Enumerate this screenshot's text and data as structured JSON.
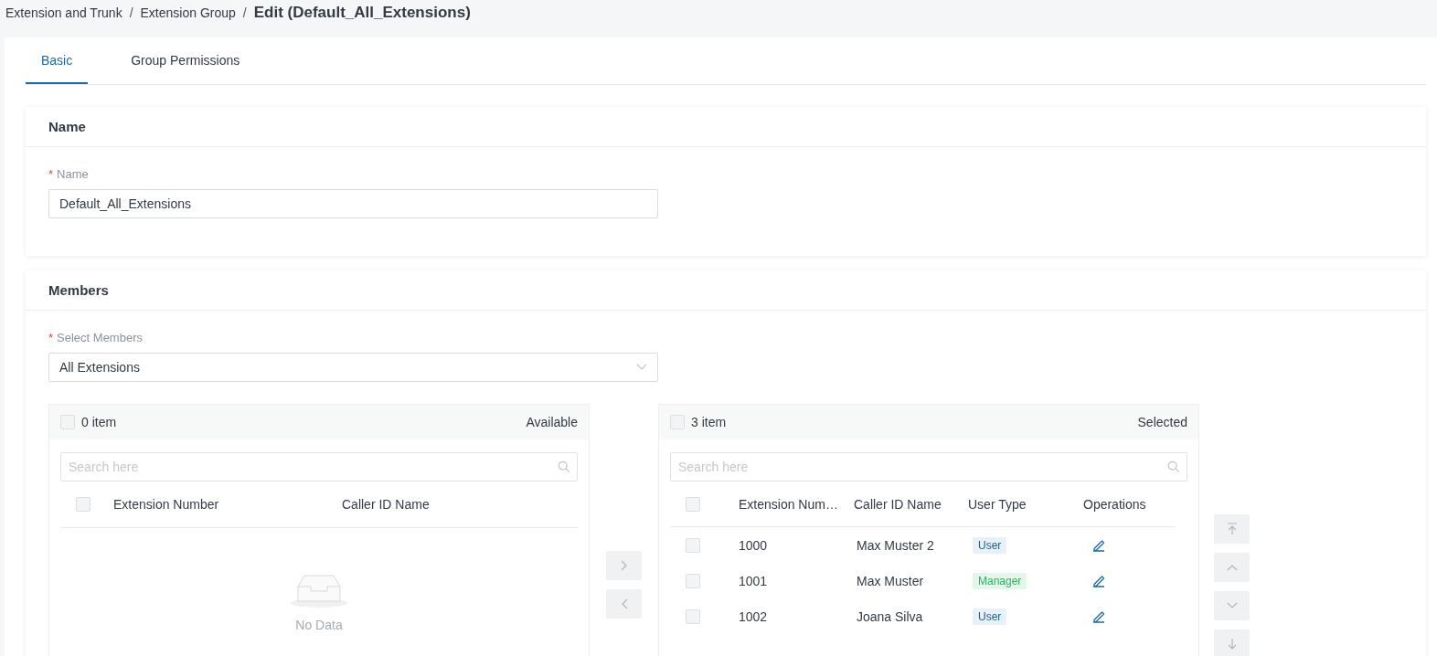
{
  "breadcrumb": {
    "items": [
      "Extension and Trunk",
      "Extension Group"
    ],
    "separator": "/",
    "current": "Edit (Default_All_Extensions)"
  },
  "tabs": [
    {
      "label": "Basic",
      "selected": true
    },
    {
      "label": "Group Permissions",
      "selected": false
    }
  ],
  "name_section": {
    "title": "Name",
    "field": {
      "required_mark": "*",
      "label": "Name",
      "value": "Default_All_Extensions"
    }
  },
  "members_section": {
    "title": "Members",
    "select": {
      "required_mark": "*",
      "label": "Select Members",
      "value": "All Extensions"
    },
    "available": {
      "checked": false,
      "count": "0 item",
      "title": "Available",
      "search_placeholder": "Search here",
      "columns": [
        "Extension Number",
        "Caller ID Name"
      ],
      "header_checked": false,
      "empty_text": "No Data"
    },
    "selected": {
      "checked": false,
      "count": "3 item",
      "title": "Selected",
      "search_placeholder": "Search here",
      "columns": [
        "Extension Num…",
        "Caller ID Name",
        "User Type",
        "Operations"
      ],
      "header_checked": false,
      "rows": [
        {
          "checked": false,
          "number": "1000",
          "name": "Max Muster 2",
          "user_type": "User",
          "kind": "user"
        },
        {
          "checked": false,
          "number": "1001",
          "name": "Max Muster",
          "user_type": "Manager",
          "kind": "manager"
        },
        {
          "checked": false,
          "number": "1002",
          "name": "Joana Silva",
          "user_type": "User",
          "kind": "user"
        }
      ]
    }
  }
}
